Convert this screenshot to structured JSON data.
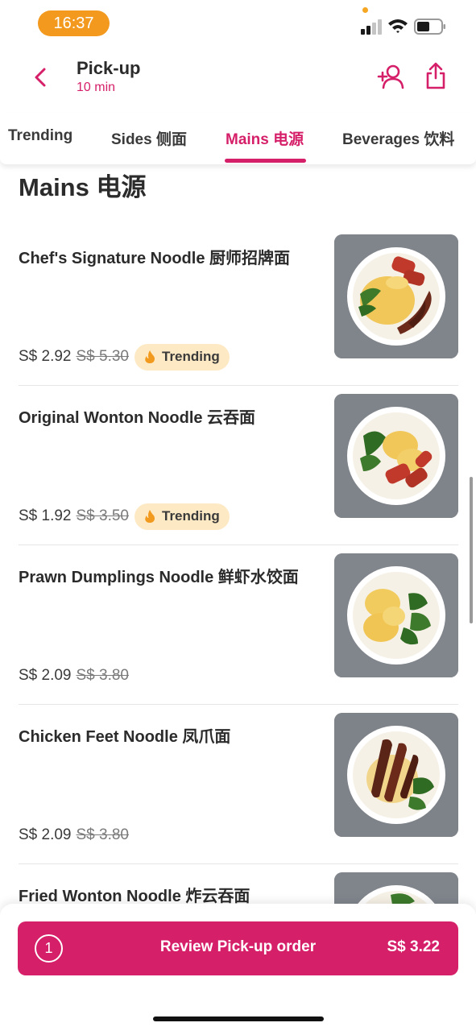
{
  "status_bar": {
    "time": "16:37"
  },
  "header": {
    "title": "Pick-up",
    "subtitle": "10 min"
  },
  "tabs": [
    {
      "label": "Trending"
    },
    {
      "label": "Sides 侧面"
    },
    {
      "label": "Mains 电源",
      "active": true
    },
    {
      "label": "Beverages 饮料"
    }
  ],
  "section": {
    "title": "Mains 电源"
  },
  "items": [
    {
      "name": "Chef's Signature Noodle 厨师招牌面",
      "price": "S$ 2.92",
      "old_price": "S$ 5.30",
      "badge": "Trending"
    },
    {
      "name": "Original Wonton Noodle 云吞面",
      "price": "S$ 1.92",
      "old_price": "S$ 3.50",
      "badge": "Trending"
    },
    {
      "name": "Prawn Dumplings Noodle 鲜虾水饺面",
      "price": "S$ 2.09",
      "old_price": "S$ 3.80"
    },
    {
      "name": "Chicken Feet Noodle 凤爪面",
      "price": "S$ 2.09",
      "old_price": "S$ 3.80"
    },
    {
      "name": "Fried Wonton Noodle 炸云吞面"
    }
  ],
  "cart": {
    "count": "1",
    "label": "Review Pick-up order",
    "total": "S$ 3.22"
  },
  "colors": {
    "brand": "#d61f69",
    "badge_bg": "#fde9c4",
    "time_pill": "#f2991e"
  }
}
